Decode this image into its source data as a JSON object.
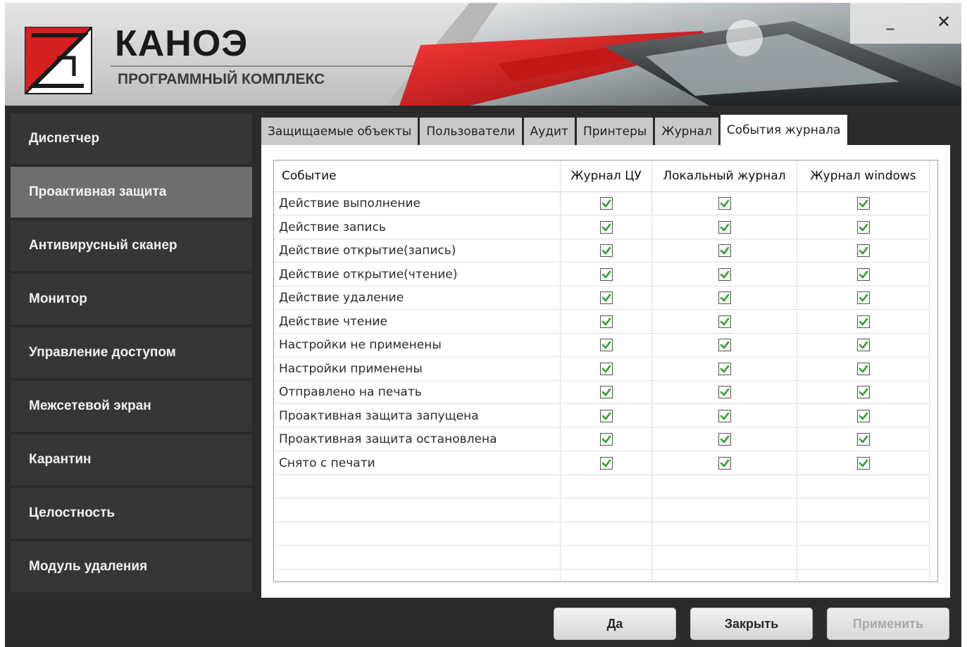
{
  "header": {
    "title": "КАНОЭ",
    "subtitle": "ПРОГРАММНЫЙ КОМПЛЕКС",
    "window_controls": {
      "minimize": "_",
      "close": "✕"
    },
    "accent_color": "#d42020"
  },
  "sidebar": {
    "items": [
      {
        "label": "Диспетчер",
        "active": false
      },
      {
        "label": "Проактивная защита",
        "active": true
      },
      {
        "label": "Антивирусный сканер",
        "active": false
      },
      {
        "label": "Монитор",
        "active": false
      },
      {
        "label": "Управление доступом",
        "active": false
      },
      {
        "label": "Межсетевой экран",
        "active": false
      },
      {
        "label": "Карантин",
        "active": false
      },
      {
        "label": "Целостность",
        "active": false
      },
      {
        "label": "Модуль удаления",
        "active": false
      }
    ]
  },
  "tabs": [
    {
      "label": "Защищаемые объекты",
      "active": false
    },
    {
      "label": "Пользователи",
      "active": false
    },
    {
      "label": "Аудит",
      "active": false
    },
    {
      "label": "Принтеры",
      "active": false
    },
    {
      "label": "Журнал",
      "active": false
    },
    {
      "label": "События журнала",
      "active": true
    }
  ],
  "table": {
    "columns": [
      "Событие",
      "Журнал ЦУ",
      "Локальный журнал",
      "Журнал windows"
    ],
    "rows": [
      {
        "event": "Действие выполнение",
        "cu": true,
        "local": true,
        "windows": true
      },
      {
        "event": "Действие запись",
        "cu": true,
        "local": true,
        "windows": true
      },
      {
        "event": "Действие открытие(запись)",
        "cu": true,
        "local": true,
        "windows": true
      },
      {
        "event": "Действие открытие(чтение)",
        "cu": true,
        "local": true,
        "windows": true
      },
      {
        "event": "Действие удаление",
        "cu": true,
        "local": true,
        "windows": true
      },
      {
        "event": "Действие чтение",
        "cu": true,
        "local": true,
        "windows": true
      },
      {
        "event": "Настройки не применены",
        "cu": true,
        "local": true,
        "windows": true
      },
      {
        "event": "Настройки применены",
        "cu": true,
        "local": true,
        "windows": true
      },
      {
        "event": "Отправлено на печать",
        "cu": true,
        "local": true,
        "windows": true
      },
      {
        "event": "Проактивная защита запущена",
        "cu": true,
        "local": true,
        "windows": true
      },
      {
        "event": "Проактивная защита остановлена",
        "cu": true,
        "local": true,
        "windows": true
      },
      {
        "event": "Снято с печати",
        "cu": true,
        "local": true,
        "windows": true
      }
    ],
    "checkbox_color": "#2fa12f"
  },
  "buttons": {
    "yes": "Да",
    "close": "Закрыть",
    "apply": "Применить"
  }
}
